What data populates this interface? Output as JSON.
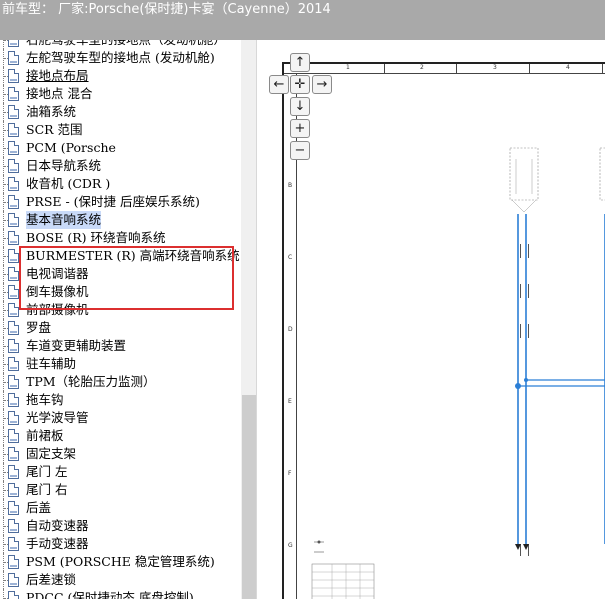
{
  "header": {
    "vehicle_label": "前车型：  厂家:Porsche(保时捷)卡宴（Cayenne）2014"
  },
  "tree": {
    "items": [
      {
        "label": "右舵驾驶车型的接地点（发动机舱）"
      },
      {
        "label": "左舵驾驶车型的接地点 (发动机舱)"
      },
      {
        "label": "接地点布局",
        "link": true
      },
      {
        "label": "接地点 混合"
      },
      {
        "label": "油箱系统"
      },
      {
        "label": "SCR 范围"
      },
      {
        "label": "PCM (Porsche"
      },
      {
        "label": "日本导航系统"
      },
      {
        "label": "收音机 (CDR )"
      },
      {
        "label": "PRSE - (保时捷 后座娱乐系统)"
      },
      {
        "label": "基本音响系统",
        "selected": true
      },
      {
        "label": "BOSE (R) 环绕音响系统"
      },
      {
        "label": "BURMESTER (R) 高端环绕音响系统"
      },
      {
        "label": "电视调谐器"
      },
      {
        "label": "倒车摄像机"
      },
      {
        "label": "前部摄像机"
      },
      {
        "label": "罗盘"
      },
      {
        "label": "车道变更辅助装置"
      },
      {
        "label": "驻车辅助"
      },
      {
        "label": "TPM（轮胎压力监测）"
      },
      {
        "label": "拖车钩"
      },
      {
        "label": "光学波导管"
      },
      {
        "label": "前裙板"
      },
      {
        "label": "固定支架"
      },
      {
        "label": "尾门 左"
      },
      {
        "label": "尾门 右"
      },
      {
        "label": "后盖"
      },
      {
        "label": "自动变速器"
      },
      {
        "label": "手动变速器"
      },
      {
        "label": "PSM (PORSCHE 稳定管理系统)"
      },
      {
        "label": "后差速锁"
      },
      {
        "label": "PDCC (保时捷动态 底盘控制)"
      }
    ]
  },
  "viewer": {
    "nav": {
      "up": "↑",
      "left": "←",
      "center": "✛",
      "right": "→",
      "down": "↓",
      "zoom_in": "+",
      "zoom_out": "−"
    },
    "diagram": {
      "columns": [
        "1",
        "2",
        "3",
        "4"
      ],
      "rows": [
        "B",
        "C",
        "D",
        "E",
        "F",
        "G"
      ],
      "accent_color": "#2b7fd6"
    }
  }
}
